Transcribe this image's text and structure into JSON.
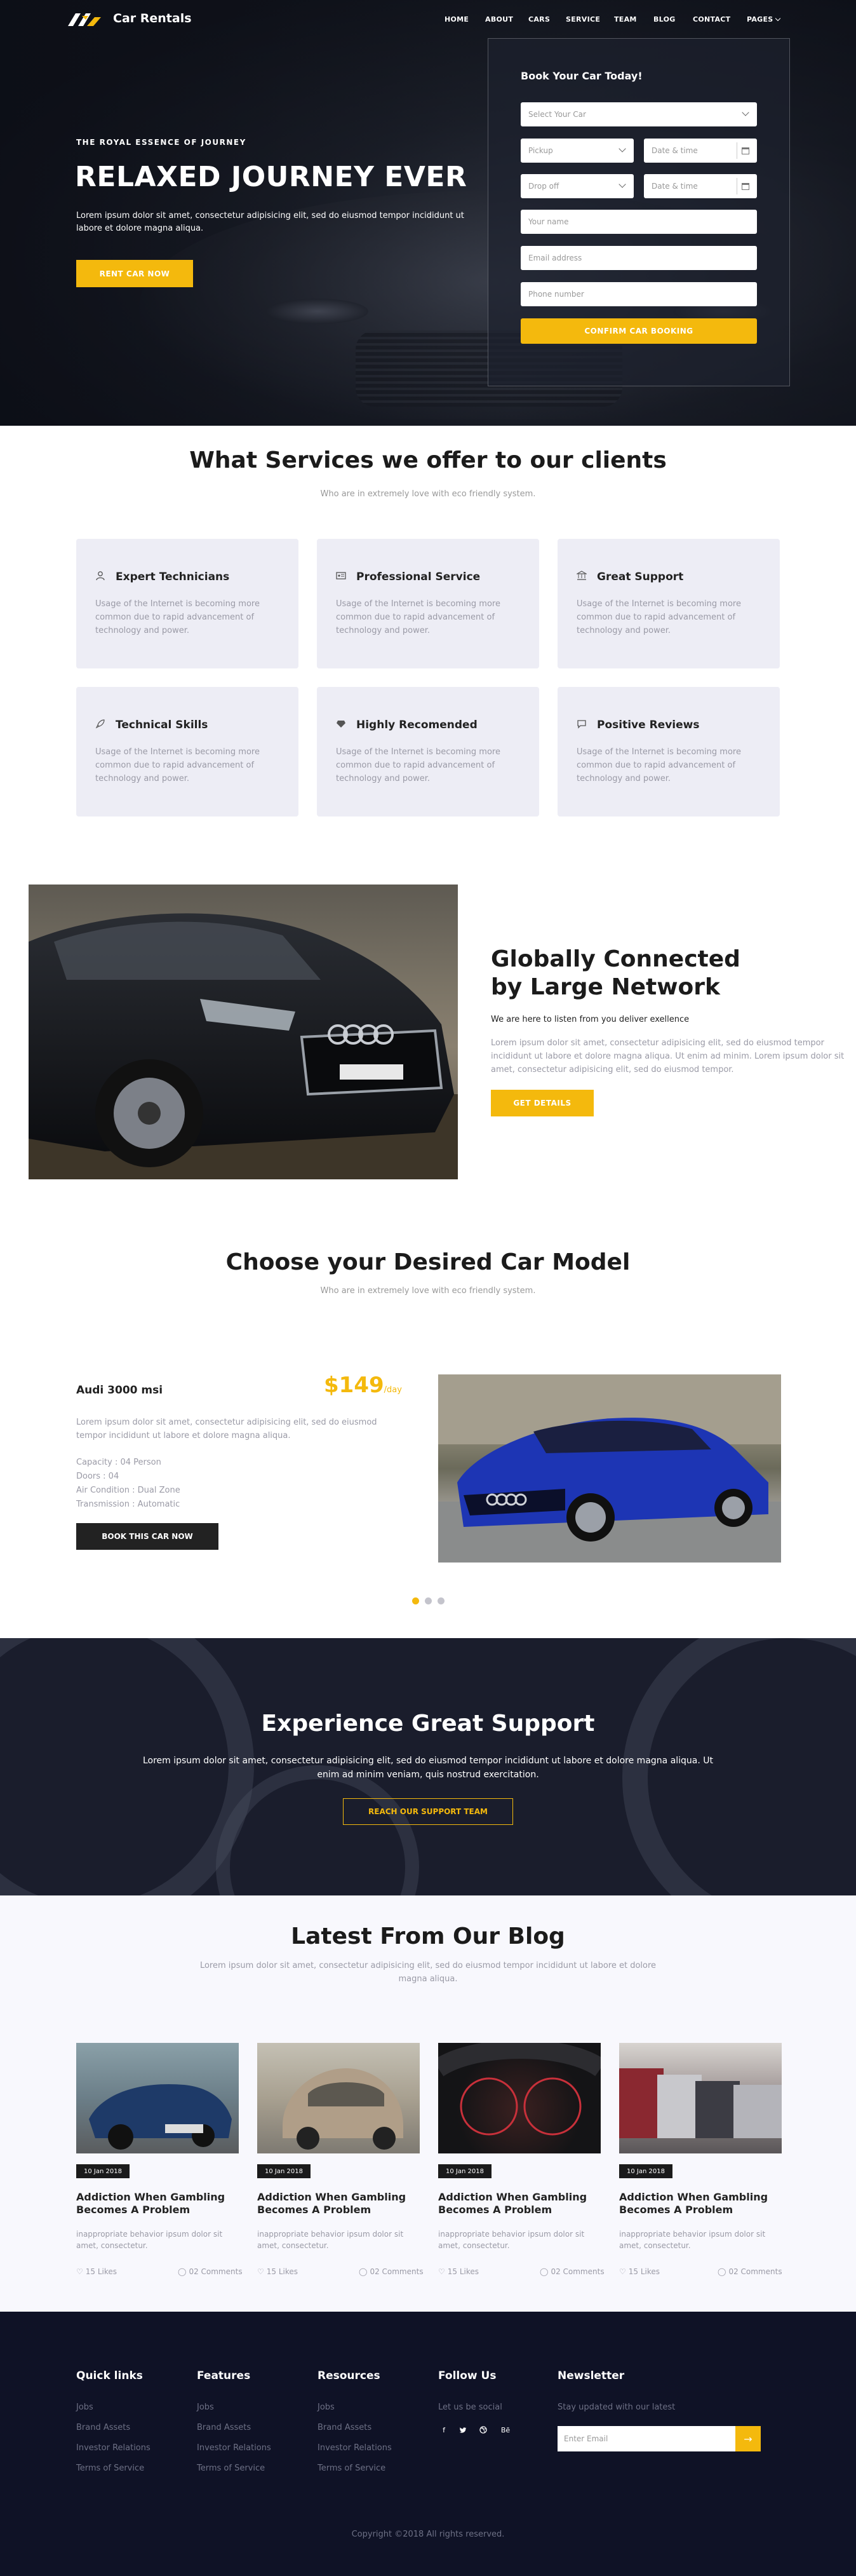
{
  "header": {
    "brand": "Car Rentals",
    "nav": [
      "HOME",
      "ABOUT",
      "CARS",
      "SERVICE",
      "TEAM",
      "BLOG",
      "CONTACT",
      "PAGES"
    ]
  },
  "hero": {
    "kicker": "THE ROYAL ESSENCE OF JOURNEY",
    "title": "RELAXED JOURNEY EVER",
    "text": "Lorem ipsum dolor sit amet, consectetur adipisicing elit, sed do eiusmod tempor incididunt ut labore et dolore magna aliqua.",
    "button": "RENT CAR NOW"
  },
  "booking": {
    "title": "Book Your Car Today!",
    "select_car": "Select Your Car",
    "pickup": "Pickup",
    "dropoff": "Drop off",
    "date_time_1": "Date & time",
    "date_time_2": "Date & time",
    "name": "Your name",
    "email": "Email address",
    "phone": "Phone number",
    "button": "CONFIRM CAR BOOKING"
  },
  "services": {
    "title": "What Services we offer to our clients",
    "subtitle": "Who are in extremely love with eco friendly system.",
    "items": [
      {
        "title": "Expert Technicians",
        "icon": "user-icon",
        "text": "Usage of the Internet is becoming more common due to rapid advancement of technology and power."
      },
      {
        "title": "Professional Service",
        "icon": "license-icon",
        "text": "Usage of the Internet is becoming more common due to rapid advancement of technology and power."
      },
      {
        "title": "Great Support",
        "icon": "bank-icon",
        "text": "Usage of the Internet is becoming more common due to rapid advancement of technology and power."
      },
      {
        "title": "Technical Skills",
        "icon": "rocket-icon",
        "text": "Usage of the Internet is becoming more common due to rapid advancement of technology and power."
      },
      {
        "title": "Highly Recomended",
        "icon": "diamond-icon",
        "text": "Usage of the Internet is becoming more common due to rapid advancement of technology and power."
      },
      {
        "title": "Positive Reviews",
        "icon": "bubble-icon",
        "text": "Usage of the Internet is becoming more common due to rapid advancement of technology and power."
      }
    ]
  },
  "global": {
    "title": "Globally Connected by Large Network",
    "subtitle": "We are here to listen from you deliver exellence",
    "text": "Lorem ipsum dolor sit amet, consectetur adipisicing elit, sed do eiusmod tempor incididunt ut labore et dolore magna aliqua. Ut enim ad minim. Lorem ipsum dolor sit amet, consectetur adipisicing elit, sed do eiusmod tempor.",
    "button": "GET DETAILS"
  },
  "car_model": {
    "title": "Choose your Desired Car Model",
    "subtitle": "Who are in extremely love with eco friendly system.",
    "name": "Audi 3000 msi",
    "price": "$149",
    "price_unit": "/day",
    "text": "Lorem ipsum dolor sit amet, consectetur adipisicing elit, sed do eiusmod tempor incididunt ut labore et dolore magna aliqua.",
    "specs": [
      "Capacity : 04 Person",
      "Doors : 04",
      "Air Condition : Dual Zone",
      "Transmission : Automatic"
    ],
    "button": "BOOK THIS CAR NOW"
  },
  "support": {
    "title": "Experience Great Support",
    "text": "Lorem ipsum dolor sit amet, consectetur adipisicing elit, sed do eiusmod tempor incididunt ut labore et dolore magna aliqua. Ut enim ad minim veniam, quis nostrud exercitation.",
    "button": "REACH OUR SUPPORT TEAM"
  },
  "blog": {
    "title": "Latest From Our Blog",
    "subtitle": "Lorem ipsum dolor sit amet, consectetur adipisicing elit, sed do eiusmod tempor incididunt ut labore et dolore magna aliqua.",
    "posts": [
      {
        "date": "10 Jan 2018",
        "title": "Addiction When Gambling Becomes A Problem",
        "text": "inappropriate behavior ipsum dolor sit amet, consectetur.",
        "likes": "15 Likes",
        "comments": "02 Comments"
      },
      {
        "date": "10 Jan 2018",
        "title": "Addiction When Gambling Becomes A Problem",
        "text": "inappropriate behavior ipsum dolor sit amet, consectetur.",
        "likes": "15 Likes",
        "comments": "02 Comments"
      },
      {
        "date": "10 Jan 2018",
        "title": "Addiction When Gambling Becomes A Problem",
        "text": "inappropriate behavior ipsum dolor sit amet, consectetur.",
        "likes": "15 Likes",
        "comments": "02 Comments"
      },
      {
        "date": "10 Jan 2018",
        "title": "Addiction When Gambling Becomes A Problem",
        "text": "inappropriate behavior ipsum dolor sit amet, consectetur.",
        "likes": "15 Likes",
        "comments": "02 Comments"
      }
    ]
  },
  "footer": {
    "quick_links": {
      "title": "Quick links",
      "items": [
        "Jobs",
        "Brand Assets",
        "Investor Relations",
        "Terms of Service"
      ]
    },
    "features": {
      "title": "Features",
      "items": [
        "Jobs",
        "Brand Assets",
        "Investor Relations",
        "Terms of Service"
      ]
    },
    "resources": {
      "title": "Resources",
      "items": [
        "Jobs",
        "Brand Assets",
        "Investor Relations",
        "Terms of Service"
      ]
    },
    "follow": {
      "title": "Follow Us",
      "text": "Let us be social",
      "icons": [
        "f",
        "t",
        "d",
        "Bē"
      ]
    },
    "newsletter": {
      "title": "Newsletter",
      "text": "Stay updated with our latest",
      "placeholder": "Enter Email",
      "button_icon": "→"
    },
    "copyright": "Copyright ©2018 All rights reserved."
  },
  "colors": {
    "accent": "#f4b90d",
    "dark": "#0f1226",
    "card": "#ededf5"
  }
}
